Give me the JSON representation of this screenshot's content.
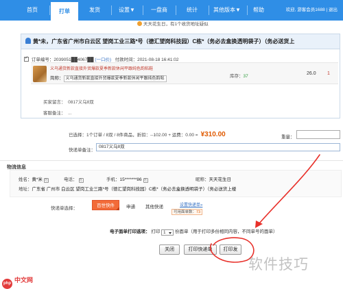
{
  "nav": {
    "items": [
      {
        "label": "首页"
      },
      {
        "label": "打单"
      },
      {
        "label": "发货"
      },
      {
        "label": "设置▼"
      },
      {
        "label": "一盘商"
      },
      {
        "label": "统计"
      },
      {
        "label": "其他版本▼"
      },
      {
        "label": "帮助"
      }
    ],
    "user": "欢迎, 游客会员1688 | 退出",
    "active_color": "#2f8ee6"
  },
  "notice": "天天花生日，有1个收货地址疑似",
  "order": {
    "header": "黄*未，广东省广州市白云区 望岗工业三路*号（德汇望岗科技园）C栋*（务必去盒换透明袋子）（务必送货上",
    "meta": {
      "order_no_label": "订单编号：",
      "order_no": "2039051██4067██",
      "link": "(一口价)",
      "paid_label": "付款时间：",
      "paid_time": "2021-08-18 16:41:02"
    },
    "item": {
      "title": "义乌通货新款直接外贸爆款夏季新款休闲平跟纯色韵粘鞋",
      "brief_label": "简称：",
      "brief": "义乌通货新款直接外贸爆款夏季新款休闲平跟纯色韵粘",
      "stock_label": "库存：",
      "stock": "37",
      "price": "26.0",
      "qty": "1"
    },
    "buyer_msg_label": "买家留言：",
    "buyer_msg": "0817义乌8双",
    "seller_memo_label": "客服备注：",
    "seller_memo": "..."
  },
  "summary": {
    "text": "已选择：1个订单 / 8双 / 8件商品，折扣：--102.00 + 运费：0.00  =",
    "total": "¥310.00",
    "weight_label": "重量："
  },
  "remark": {
    "label": "快递单备注：",
    "value": "0817义乌8双"
  },
  "receiver": {
    "section_title": "物流信息",
    "name_label": "姓名：",
    "name": "黄*米",
    "phone_label": "电话：",
    "mobile_label": "手机：",
    "mobile": "15*******86",
    "nick_label": "昵称：",
    "nick": "天天花生日",
    "addr_label": "地址：",
    "addr": "广东省 广州市 白云区 望岗工业三路*号（德汇望岗科技园）C栋*（务必去盒换透明袋子）（务必送货上楼"
  },
  "shipping": {
    "label": "快递单选择：",
    "selected": "百世快件",
    "opt1": "申通",
    "opt2": "其他快递",
    "link": "设置快递单»",
    "tip_prefix": "可用面单数：",
    "tip_count": "73"
  },
  "print": {
    "label": "电子面单打印选项：",
    "prefix": "打印",
    "copies": "1",
    "suffix": "份面单（用于打印多份相同内容，不同单号的面单）"
  },
  "buttons": {
    "close": "关闭",
    "print_express": "打印快递单",
    "print_ship": "打印发"
  },
  "watermark": {
    "text": "软件技巧",
    "php": "中文网",
    "php_badge": "php"
  }
}
